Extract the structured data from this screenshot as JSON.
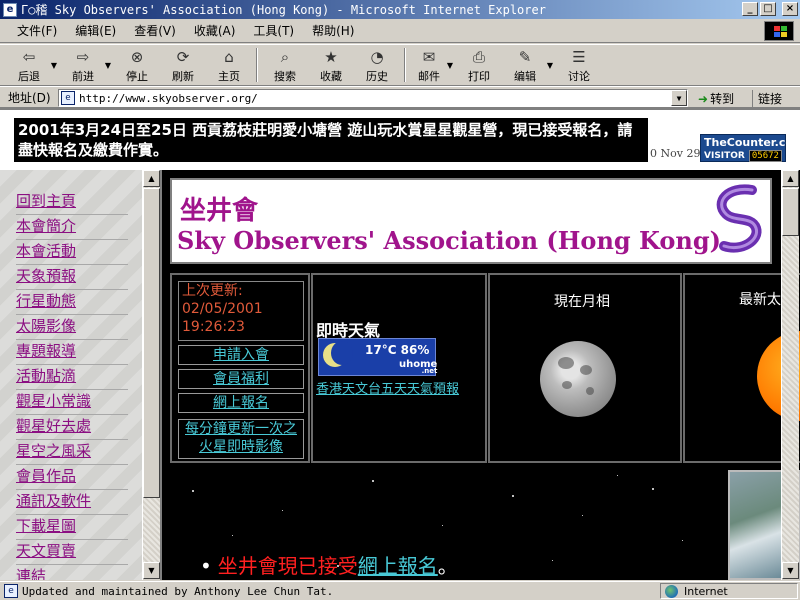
{
  "window": {
    "title": "Γ○稽 Sky Observers' Association (Hong Kong) - Microsoft Internet Explorer",
    "buttons": {
      "minimize": "_",
      "maximize": "□",
      "close": "×"
    }
  },
  "menu": [
    "文件(F)",
    "编辑(E)",
    "查看(V)",
    "收藏(A)",
    "工具(T)",
    "帮助(H)"
  ],
  "toolbar": {
    "back": "后退",
    "forward": "前进",
    "stop": "停止",
    "refresh": "刷新",
    "home": "主页",
    "search": "搜索",
    "favorites": "收藏",
    "history": "历史",
    "mail": "邮件",
    "print": "打印",
    "edit": "编辑",
    "discuss": "讨论"
  },
  "addressbar": {
    "label": "地址(D)",
    "url": "http://www.skyobserver.org/",
    "go": "转到",
    "links": "链接"
  },
  "banner": {
    "announcement": "2001年3月24日至25日 西貢荔枝莊明愛小塘營 遊山玩水賞星星觀星營，現已接受報名，請盡快報名及繳費作實。",
    "ticker": "0 Nov 29",
    "counter_name": "TheCounter.com",
    "counter_visitor": "VISITOR",
    "counter_value": "05672"
  },
  "nav": {
    "items": [
      "回到主頁",
      "本會簡介",
      "本會活動",
      "天象預報",
      "行星動態",
      "太陽影像",
      "專題報導",
      "活動點滴",
      "觀星小常識",
      "觀星好去處",
      "星空之風采",
      "會員作品",
      "通訊及軟件",
      "下載星圖",
      "天文買賣",
      "連結"
    ]
  },
  "header": {
    "chinese_name": "坐井會",
    "english_name": "Sky Observers' Association (Hong Kong)"
  },
  "update": {
    "label": "上次更新:",
    "date": "02/05/2001",
    "time": "19:26:23"
  },
  "side_links": [
    "申請入會",
    "會員福利",
    "網上報名",
    "每分鐘更新一次之火星即時影像"
  ],
  "weather": {
    "title": "即時天氣",
    "reading": "17°C 86%",
    "brand": "uhome",
    "brand_suffix": ".net",
    "forecast_link": "香港天文台五天天氣預報"
  },
  "moon": {
    "title": "現在月相"
  },
  "sun": {
    "title": "最新太"
  },
  "notice": {
    "bullet": "•",
    "text": "坐井會現已接受",
    "link": "網上報名",
    "end": "。"
  },
  "status": {
    "text": "Updated and maintained by Anthony Lee Chun Tat.",
    "zone": "Internet"
  },
  "colors": {
    "title_gradient_start": "#0a246a",
    "title_gradient_end": "#a6caf0",
    "brand_purple": "#a0148c",
    "nav_link": "#8b0f82",
    "update_text": "#e05a3a",
    "cyan_link": "#48c9d6",
    "notice_red": "#ff2020"
  }
}
